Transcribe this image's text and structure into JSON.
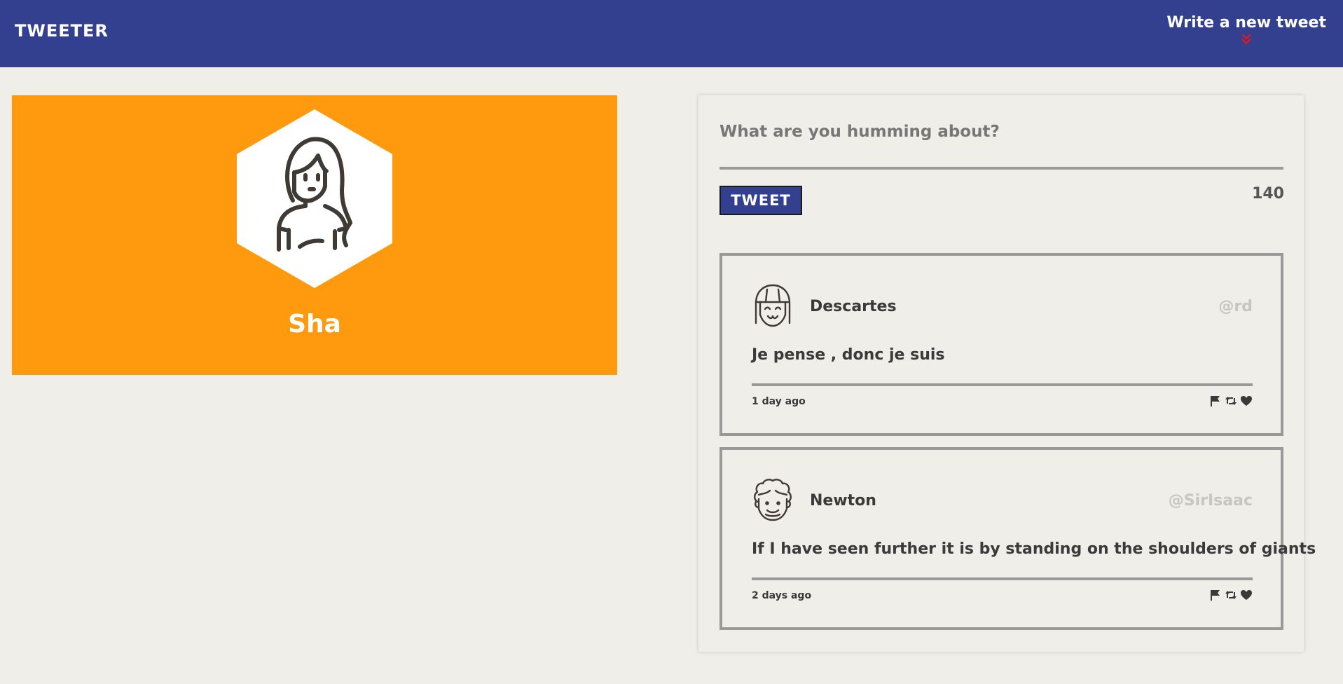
{
  "nav": {
    "brand": "TWEETER",
    "compose_label": "Write a new tweet"
  },
  "profile": {
    "name": "Sha"
  },
  "composer": {
    "placeholder": "What are you humming about?",
    "button_label": "TWEET",
    "counter": "140"
  },
  "tweets": [
    {
      "author": "Descartes",
      "handle": "@rd",
      "text": "Je pense , donc je suis",
      "time": "1 day ago"
    },
    {
      "author": "Newton",
      "handle": "@SirIsaac",
      "text": "If I have seen further it is by standing on the shoulders of giants",
      "time": "2 days ago"
    }
  ],
  "colors": {
    "nav_bg": "#33408f",
    "profile_bg": "#ff9a0e",
    "page_bg": "#f0eee8",
    "chevron": "#e0181f"
  }
}
